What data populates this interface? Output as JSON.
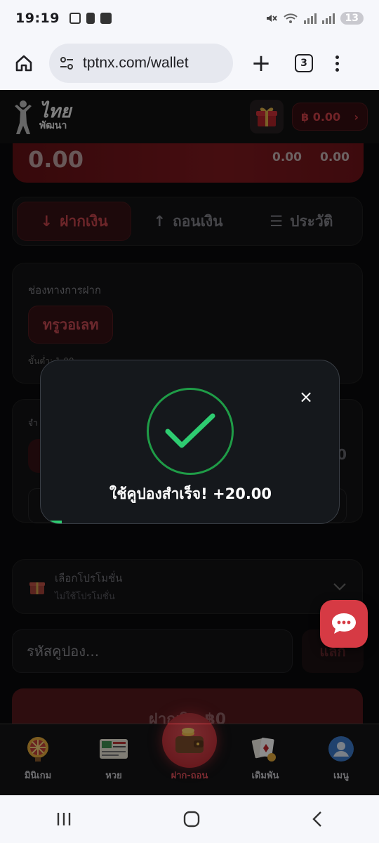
{
  "status_bar": {
    "time": "19:19",
    "notifications_badge": "13"
  },
  "browser": {
    "url": "tptnx.com/wallet",
    "tab_count": "3"
  },
  "app_header": {
    "logo_line1": "ไทย",
    "logo_line2": "พัฒนา",
    "balance": "฿ 0.00",
    "chevron": "›"
  },
  "balance_card": {
    "amount": "0.00",
    "stat1": "0.00",
    "stat2": "0.00"
  },
  "tabs": [
    {
      "icon": "↓",
      "label": "ฝากเงิน",
      "active": true
    },
    {
      "icon": "↑",
      "label": "ถอนเงิน",
      "active": false
    },
    {
      "icon": "☰",
      "label": "ประวัติ",
      "active": false
    }
  ],
  "channel": {
    "label": "ช่องทางการฝาก",
    "option": "ทรูวอเลท",
    "minimum": "ขั้นต่ำ: 1.00"
  },
  "amount_section": {
    "label": "จำ",
    "value": "0"
  },
  "promo": {
    "title": "เลือกโปรโมชั่น",
    "subtitle": "ไม่ใช้โปรโมชั่น"
  },
  "coupon": {
    "placeholder": "รหัสคูปอง...",
    "redeem_label": "แลก"
  },
  "deposit_button": {
    "label": "ฝากเงิน ฿0"
  },
  "modal": {
    "message": "ใช้คูปองสำเร็จ! +20.00",
    "close_symbol": "×",
    "progress_fraction": 0.07
  },
  "bottom_nav": [
    {
      "label": "มินิเกม",
      "icon": "wheel-icon"
    },
    {
      "label": "หวย",
      "icon": "lottery-ticket-icon"
    },
    {
      "label": "ฝาก-ถอน",
      "icon": "wallet-icon"
    },
    {
      "label": "เดิมพัน",
      "icon": "cards-icon"
    },
    {
      "label": "เมนู",
      "icon": "user-icon"
    }
  ],
  "colors": {
    "accent": "#d94a52",
    "success": "#1f9c47",
    "background": "#0b0b0c"
  }
}
